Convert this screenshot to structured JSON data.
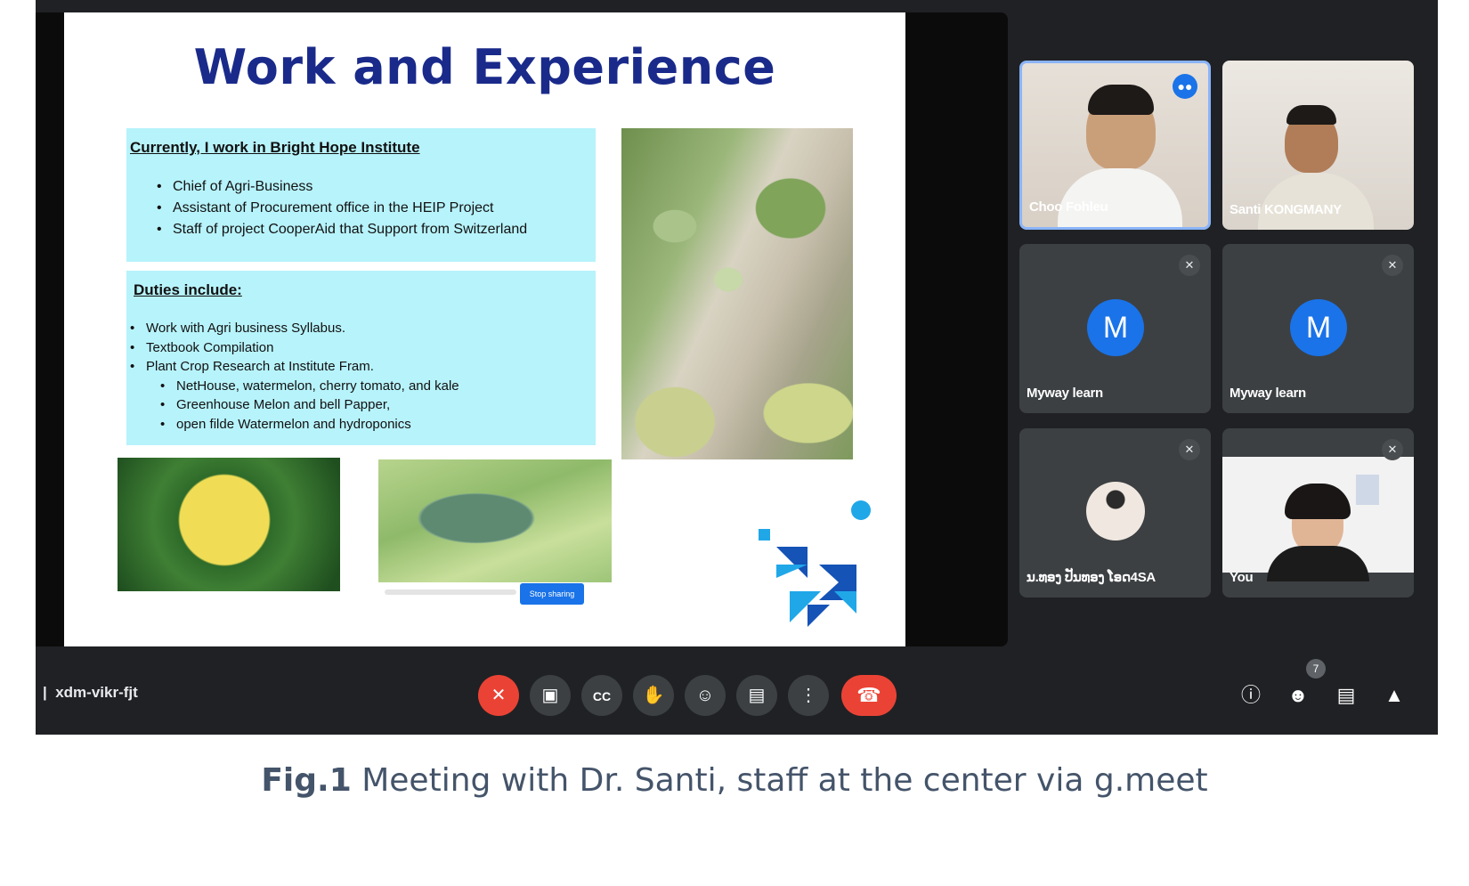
{
  "slide": {
    "title": "Work and Experience",
    "box1": {
      "heading": "Currently, I work in Bright Hope Institute",
      "items": [
        "Chief of Agri-Business",
        "Assistant of Procurement office in the HEIP Project",
        "Staff of project CooperAid that Support from Switzerland"
      ]
    },
    "box2": {
      "heading": "Duties include:",
      "items": [
        "Work with  Agri business Syllabus.",
        "Textbook Compilation",
        "Plant Crop Research at Institute Fram."
      ],
      "subitems": [
        "NetHouse, watermelon, cherry tomato, and kale",
        "Greenhouse Melon and bell Papper,",
        "open filde Watermelon and hydroponics"
      ]
    },
    "stop_sharing_label": "Stop sharing"
  },
  "participants": [
    {
      "name": "Choo Fohleu",
      "state": "speaking"
    },
    {
      "name": "Santi KONGMANY",
      "state": "video"
    },
    {
      "name": "Myway learn",
      "initial": "M",
      "state": "muted"
    },
    {
      "name": "Myway learn",
      "initial": "M",
      "state": "muted"
    },
    {
      "name": "ນ.ທອງ ປັນທອງ ໂອດ4SA",
      "state": "muted"
    },
    {
      "name": "You",
      "state": "muted"
    }
  ],
  "controls": {
    "meeting_code": "xdm-vikr-fjt",
    "people_count": "7"
  },
  "caption": {
    "label": "Fig.1",
    "text": " Meeting with Dr. Santi, staff at the center via g.meet"
  },
  "colors": {
    "accent": "#1a73e8",
    "danger": "#ea4335",
    "slide_title": "#1a2a8a",
    "slide_box": "#b7f3fb",
    "background_dark": "#202124",
    "tile": "#3c4043"
  },
  "icons": [
    "mic-off-icon",
    "camera-icon",
    "captions-icon",
    "raise-hand-icon",
    "emoji-icon",
    "present-icon",
    "more-icon",
    "end-call-icon",
    "info-icon",
    "people-icon",
    "chat-icon",
    "activities-icon"
  ]
}
